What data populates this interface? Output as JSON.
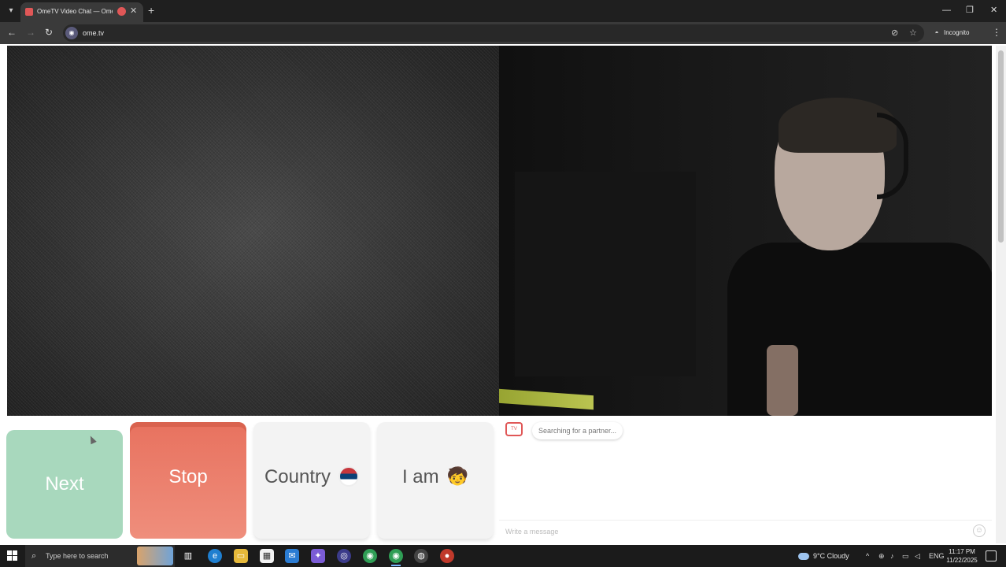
{
  "browser": {
    "tab_title": "OmeTV Video Chat — Ome",
    "url": "ome.tv",
    "incognito_label": "Incognito"
  },
  "buttons": {
    "next": "Next",
    "stop": "Stop",
    "country": "Country",
    "i_am": "I am",
    "i_am_emoji": "🧒"
  },
  "chat": {
    "status": "Searching for a partner...",
    "input_placeholder": "Write a message"
  },
  "taskbar": {
    "search_placeholder": "Type here to search",
    "weather": "9°C  Cloudy",
    "language": "ENG",
    "time": "11:17 PM",
    "date": "11/22/2025"
  },
  "icons": {
    "tab_list": "chevron-down-icon",
    "new_tab": "plus-icon",
    "back": "arrow-left-icon",
    "forward": "arrow-right-icon",
    "reload": "reload-icon",
    "eye_off": "eye-off-icon",
    "bookmark": "star-icon",
    "menu": "kebab-menu-icon",
    "country_flag": "serbia-flag-icon",
    "smile": "smile-icon"
  }
}
